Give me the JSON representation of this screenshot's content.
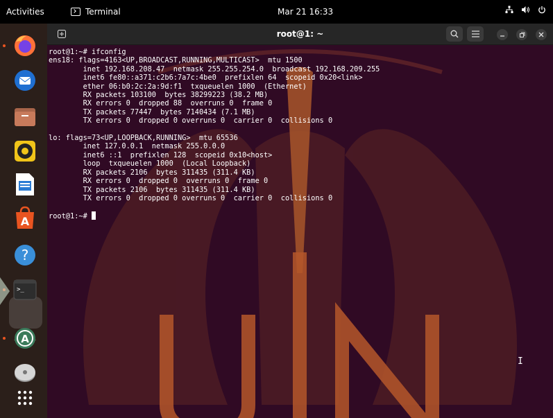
{
  "topbar": {
    "activities": "Activities",
    "app_name": "Terminal",
    "clock": "Mar 21  16:33",
    "tray": {
      "network": "⛁",
      "volume": "🔊",
      "power": "⏻"
    }
  },
  "dock": {
    "items": [
      {
        "name": "firefox",
        "icon": "firefox-icon",
        "running": true
      },
      {
        "name": "thunderbird",
        "icon": "thunderbird-icon"
      },
      {
        "name": "files",
        "icon": "files-icon"
      },
      {
        "name": "rhythmbox",
        "icon": "rhythmbox-icon"
      },
      {
        "name": "writer",
        "icon": "libreoffice-writer-icon"
      },
      {
        "name": "software",
        "icon": "ubuntu-software-icon"
      },
      {
        "name": "help",
        "icon": "help-icon",
        "label": "?"
      },
      {
        "name": "terminal",
        "icon": "terminal-icon",
        "label": ">_",
        "running": true,
        "active": true
      },
      {
        "name": "software-updater",
        "icon": "software-updater-icon",
        "running": true
      },
      {
        "name": "disc",
        "icon": "optical-drive-icon"
      },
      {
        "name": "show-apps",
        "icon": "app-grid-icon"
      }
    ]
  },
  "terminal": {
    "title": "root@1: ~",
    "lines": [
      "root@1:~# ifconfig",
      "ens18: flags=4163<UP,BROADCAST,RUNNING,MULTICAST>  mtu 1500",
      "        inet 192.168.208.47  netmask 255.255.254.0  broadcast 192.168.209.255",
      "        inet6 fe80::a371:c2b6:7a7c:4be0  prefixlen 64  scopeid 0x20<link>",
      "        ether 06:b0:2c:2a:9d:f1  txqueuelen 1000  (Ethernet)",
      "        RX packets 103100  bytes 38299223 (38.2 MB)",
      "        RX errors 0  dropped 88  overruns 0  frame 0",
      "        TX packets 77447  bytes 7140434 (7.1 MB)",
      "        TX errors 0  dropped 0 overruns 0  carrier 0  collisions 0",
      "",
      "lo: flags=73<UP,LOOPBACK,RUNNING>  mtu 65536",
      "        inet 127.0.0.1  netmask 255.0.0.0",
      "        inet6 ::1  prefixlen 128  scopeid 0x10<host>",
      "        loop  txqueuelen 1000  (Local Loopback)",
      "        RX packets 2106  bytes 311435 (311.4 KB)",
      "        RX errors 0  dropped 0  overruns 0  frame 0",
      "        TX packets 2106  bytes 311435 (311.4 KB)",
      "        TX errors 0  dropped 0 overruns 0  carrier 0  collisions 0",
      "",
      "root@1:~# "
    ],
    "wallpaper_text": "UIN",
    "colors": {
      "background": "#300a24",
      "watermark": "#c7652e"
    }
  }
}
